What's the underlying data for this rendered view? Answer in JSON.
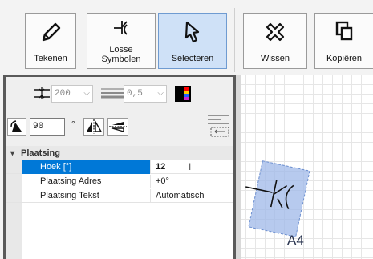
{
  "toolbar": {
    "draw_label": "Tekenen",
    "loose_symbols_label_1": "Losse",
    "loose_symbols_label_2": "Symbolen",
    "select_label": "Selecteren",
    "delete_label": "Wissen",
    "copy_label": "Kopiëren"
  },
  "controls": {
    "line_spacing": "200",
    "line_width": "0,5",
    "rotation_angle": "90",
    "degree_symbol": "°"
  },
  "properties": {
    "category": "Plaatsing",
    "rows": [
      {
        "name": "Hoek [°]",
        "value": "12"
      },
      {
        "name": "Plaatsing Adres",
        "value": "+0°"
      },
      {
        "name": "Plaatsing Tekst",
        "value": "Automatisch"
      }
    ]
  },
  "canvas": {
    "symbol_label": "A4"
  },
  "colors": {
    "accent": "#0078d7",
    "selection_fill": "#9fb8e8",
    "active_tool": "#cfe1f7"
  }
}
